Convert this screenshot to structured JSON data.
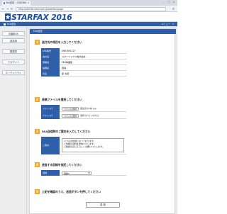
{
  "browser": {
    "tab_title": "FAX送信 - STARFAX",
    "url": "http://sf2016.example.jp/webfax/page",
    "window_controls": [
      "–",
      "□",
      "×"
    ]
  },
  "header": {
    "logo_text": "STARFAX 2016",
    "subnav_label": "FAX送信",
    "subnav_right": "メニュー"
  },
  "sidebar": {
    "items": [
      {
        "label": "情報BOX"
      },
      {
        "label": "送信済"
      },
      {
        "label": "履歴表"
      },
      {
        "label": "アカウント"
      },
      {
        "label": "ユーティリティ"
      }
    ]
  },
  "panel": {
    "title": "FAX送信"
  },
  "step1": {
    "number": "1",
    "title": "送付先の項目を入力してください",
    "rows": [
      {
        "label": "FAX番号",
        "value": "0667891227"
      },
      {
        "label": "会社名",
        "value": "スターファクス株式会社"
      },
      {
        "label": "部署名",
        "value": "FAX事業部"
      },
      {
        "label": "役職名",
        "value": "部長"
      },
      {
        "label": "氏名",
        "value": "星 太郎"
      }
    ]
  },
  "step2": {
    "number": "2",
    "title": "原稿ファイルを選択してください",
    "rows": [
      {
        "label": "ファイル1",
        "button": "ファイル選択",
        "filename": "発送表の1枚.jpg"
      },
      {
        "label": "ファイル2",
        "button": "ファイル選択",
        "filename": "選択されていません"
      }
    ]
  },
  "step3": {
    "number": "3",
    "title": "FAX送信時のご案内を入力してください",
    "label": "ご案内",
    "text": "いつもお世話になっております。\nご依頼の資料を送信いたします。\nご確認のほどよろしくお願いいたします。"
  },
  "step4": {
    "number": "4",
    "title": "送信する回線を指定してください",
    "label": "回線",
    "selected": "回線1"
  },
  "step5": {
    "number": "5",
    "title": "上記を確認のうえ、送信ボタンを押してください",
    "button": "送 信"
  },
  "colors": {
    "brand_blue": "#2f5fa8",
    "step_orange": "#f5a623",
    "logo_blue": "#1a4fa0"
  }
}
